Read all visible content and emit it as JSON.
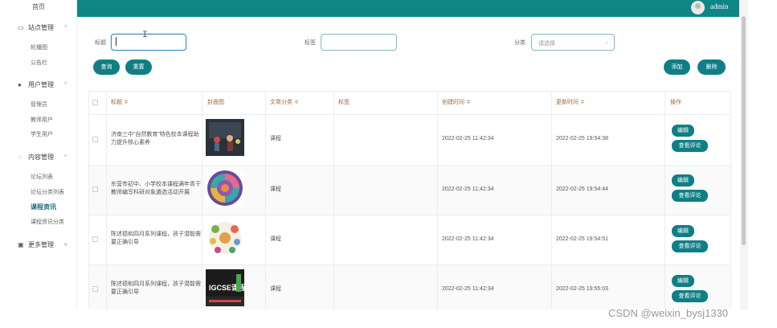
{
  "sidebar": {
    "top_item": "首页",
    "groups": [
      {
        "label": "站点管理",
        "icon": "monitor-icon",
        "items": [
          "轮播图",
          "公告栏"
        ]
      },
      {
        "label": "用户管理",
        "icon": "user-icon",
        "items": [
          "管理员",
          "教师用户",
          "学生用户"
        ]
      },
      {
        "label": "内容管理",
        "icon": "chat-icon",
        "items": [
          "论坛列表",
          "论坛分类列表",
          "课程资讯",
          "课程资讯分类"
        ]
      },
      {
        "label": "更多管理",
        "icon": "pages-icon",
        "items": []
      }
    ],
    "active_item": "课程资讯"
  },
  "header": {
    "username": "admin",
    "bg": "#0f8585"
  },
  "search": {
    "title_label": "标题",
    "title_value": "",
    "tag_label": "标签",
    "tag_value": "",
    "category_label": "分类",
    "category_placeholder": "请选择"
  },
  "toolbar": {
    "query": "查询",
    "reset": "重置",
    "add": "添加",
    "delete": "删除"
  },
  "table": {
    "headers": [
      "标题 ≑",
      "封面图",
      "文章分类 ≑",
      "标签",
      "创建时间 ≑",
      "更新时间 ≑",
      "操作"
    ],
    "rows": [
      {
        "title": "济南三中”自然教育”特色校本课程助力提升核心素养",
        "category": "课程",
        "tag": "",
        "created": "2022-02-25 11:42:34",
        "updated": "2022-02-25 19:54:38",
        "thumb": "photo-dark"
      },
      {
        "title": "东营市初中、小学校本课程满年青干教师编写科研对象遴选活动开展",
        "category": "课程",
        "tag": "",
        "created": "2022-02-25 11:42:34",
        "updated": "2022-02-25 19:54:44",
        "thumb": "wheel-chart"
      },
      {
        "title": "陈述德和四月系列课程，孩子潜能需要正确引导",
        "category": "课程",
        "tag": "",
        "created": "2022-02-25 11:42:34",
        "updated": "2022-02-25 19:54:51",
        "thumb": "food-circle"
      },
      {
        "title": "陈述德和四月系列课程，孩子潜能需要正确引导",
        "category": "课程",
        "tag": "",
        "created": "2022-02-25 11:42:34",
        "updated": "2022-02-25 19:55:03",
        "thumb": "igcse-banner"
      }
    ],
    "row_actions": {
      "edit": "编辑",
      "comments": "查看评论"
    },
    "thumb_text": "IGCSE课程"
  },
  "accent": "#0f7f85",
  "watermark": "CSDN @weixin_bysj1330"
}
